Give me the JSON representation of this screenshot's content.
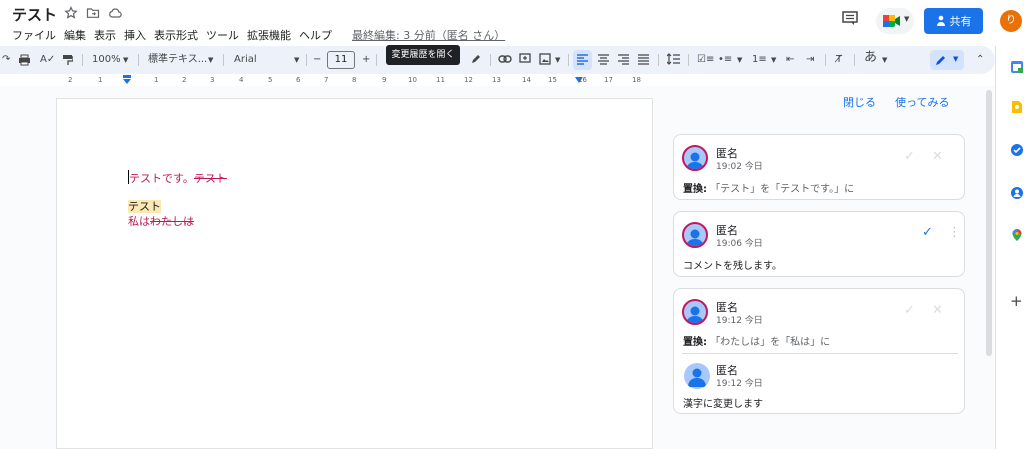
{
  "doc": {
    "title": "テスト",
    "last_edit": "最終編集: 3 分前（匿名 さん）",
    "tooltip": "変更履歴を開く"
  },
  "menu": [
    "ファイル",
    "編集",
    "表示",
    "挿入",
    "表示形式",
    "ツール",
    "拡張機能",
    "ヘルプ"
  ],
  "header": {
    "share_label": "共有",
    "user_initial": "り"
  },
  "toolbar": {
    "zoom": "100%",
    "style": "標準テキス...",
    "font": "Arial",
    "font_size": "11",
    "minus": "−",
    "plus": "+",
    "input_tool": "あ"
  },
  "ruler": [
    "2",
    "1",
    "1",
    "2",
    "3",
    "4",
    "5",
    "6",
    "7",
    "8",
    "9",
    "10",
    "11",
    "12",
    "13",
    "14",
    "15",
    "16",
    "17",
    "18"
  ],
  "body": {
    "line1_ins": "テストです。",
    "line1_del": "テスト",
    "line2": "テスト",
    "line3_ins": "私は",
    "line3_del": "わたしは"
  },
  "panel": {
    "close": "閉じる",
    "try": "使ってみる"
  },
  "comments": [
    {
      "author": "匿名",
      "time": "19:02 今日",
      "label": "置換:",
      "body": "「テスト」を「テストです。」に"
    },
    {
      "author": "匿名",
      "time": "19:06 今日",
      "body": "コメントを残します。"
    },
    {
      "author": "匿名",
      "time": "19:12 今日",
      "label": "置換:",
      "body": "「わたしは」を「私は」に",
      "reply": {
        "author": "匿名",
        "time": "19:12 今日",
        "body": "漢字に変更します"
      }
    }
  ],
  "colors": {
    "accent": "#1a73e8",
    "suggestion": "#c2185b",
    "toolbar_bg": "#edf2fa",
    "avatar_orange": "#e8710a"
  }
}
